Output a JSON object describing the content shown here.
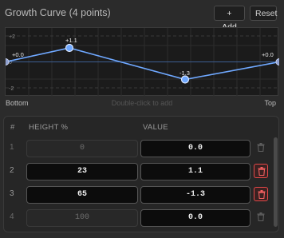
{
  "header": {
    "title": "Growth Curve (4 points)",
    "add_label": "+ Add",
    "reset_label": "Reset"
  },
  "graph": {
    "y_ticks": [
      "+2",
      "0",
      "-2"
    ],
    "point_labels": [
      "+0.0",
      "+1.1",
      "-1.3",
      "+0.0"
    ],
    "points": [
      {
        "height": 0,
        "value": 0.0
      },
      {
        "height": 23,
        "value": 1.1
      },
      {
        "height": 65,
        "value": -1.3
      },
      {
        "height": 100,
        "value": 0.0
      }
    ],
    "bottom_label": "Bottom",
    "hint": "Double-click to add",
    "top_label": "Top",
    "colors": {
      "line": "#6fa8ff",
      "point": "#6fa8ff",
      "endpoint": "#8fa0d0"
    }
  },
  "table": {
    "columns": [
      "#",
      "HEIGHT %",
      "VALUE"
    ],
    "rows": [
      {
        "index": "1",
        "height": "0",
        "value": "0.0",
        "deletable": false
      },
      {
        "index": "2",
        "height": "23",
        "value": "1.1",
        "deletable": true
      },
      {
        "index": "3",
        "height": "65",
        "value": "-1.3",
        "deletable": true
      },
      {
        "index": "4",
        "height": "100",
        "value": "0.0",
        "deletable": false
      }
    ]
  }
}
